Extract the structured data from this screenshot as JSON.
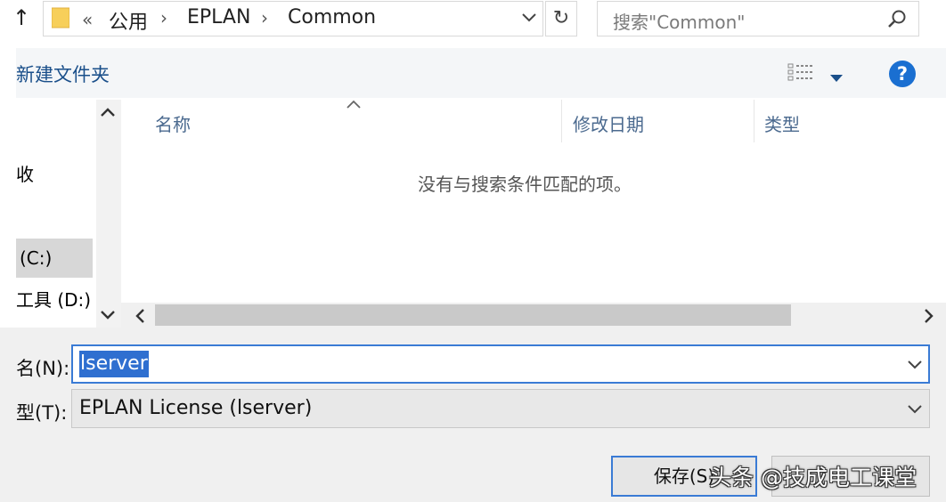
{
  "navigation": {
    "up_glyph": "↑"
  },
  "address_bar": {
    "overflow_glyph": "«",
    "crumbs": [
      "公用",
      "EPLAN",
      "Common"
    ],
    "separator": "›",
    "refresh_glyph": "↻"
  },
  "search": {
    "placeholder": "搜索\"Common\"",
    "icon": "search-icon"
  },
  "toolbar": {
    "new_folder_label": "新建文件夹",
    "help_glyph": "?"
  },
  "nav_pane": {
    "items": [
      {
        "label": "收"
      },
      {
        "label": "(C:)",
        "selected": true
      },
      {
        "label": "工具 (D:)"
      }
    ]
  },
  "file_list": {
    "columns": [
      "名称",
      "修改日期",
      "类型"
    ],
    "empty_message": "没有与搜索条件匹配的项。"
  },
  "form": {
    "filename_label": "名(N):",
    "filename_value": "lserver",
    "filetype_label": "型(T):",
    "filetype_value": "EPLAN License (lserver)"
  },
  "buttons": {
    "save_label": "保存(S)"
  },
  "watermark": "头条 @技成电工课堂",
  "colors": {
    "accent": "#3a7bd5",
    "selection": "#2f6fd0",
    "link": "#1a4f8a",
    "help": "#1a6fd1"
  }
}
